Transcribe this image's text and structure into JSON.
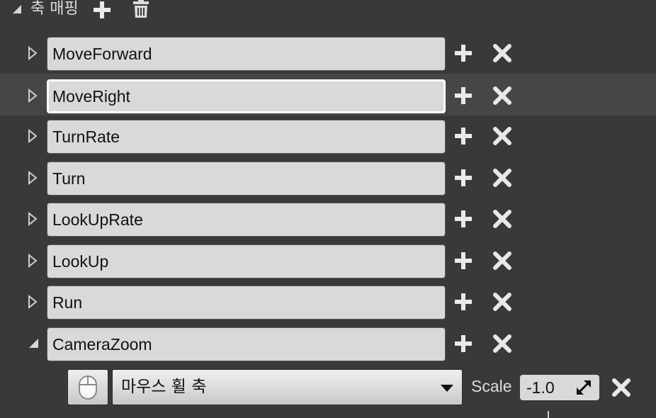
{
  "section": {
    "title": "축 매핑",
    "add_icon": "plus-icon",
    "delete_icon": "trash-icon"
  },
  "mappings": [
    {
      "name": "MoveForward",
      "expanded": false,
      "focused": false
    },
    {
      "name": "MoveRight",
      "expanded": false,
      "focused": true
    },
    {
      "name": "TurnRate",
      "expanded": false,
      "focused": false
    },
    {
      "name": "Turn",
      "expanded": false,
      "focused": false
    },
    {
      "name": "LookUpRate",
      "expanded": false,
      "focused": false
    },
    {
      "name": "LookUp",
      "expanded": false,
      "focused": false
    },
    {
      "name": "Run",
      "expanded": false,
      "focused": false
    },
    {
      "name": "CameraZoom",
      "expanded": true,
      "focused": false
    }
  ],
  "camera_zoom_binding": {
    "key_icon": "mouse-icon",
    "key": "마우스 휠 축",
    "scale_label": "Scale",
    "scale_value": "-1.0"
  },
  "colors": {
    "panel_bg": "#393939",
    "hover_row_bg": "#464646",
    "field_bg": "#d9d9d9",
    "icon": "#e8e8e8"
  }
}
